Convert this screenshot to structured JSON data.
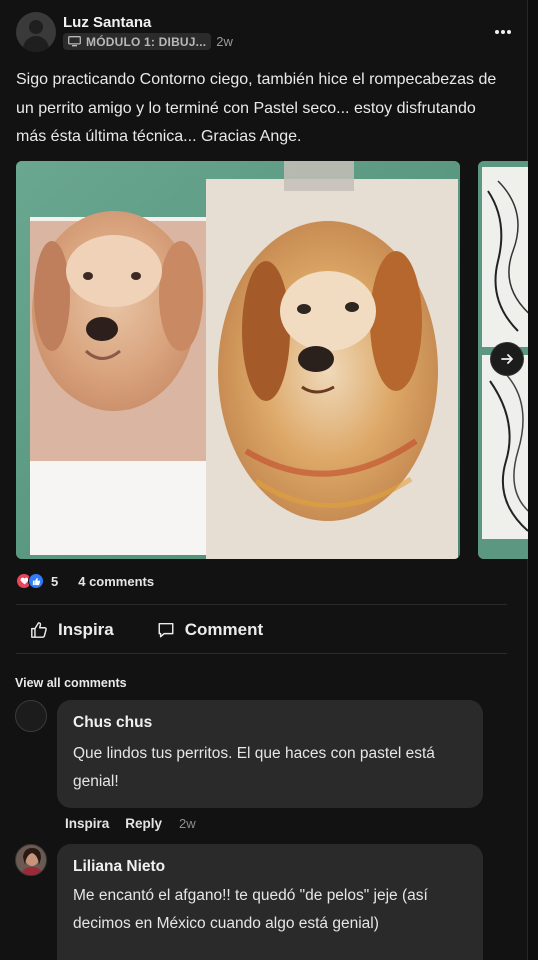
{
  "post": {
    "author": "Luz Santana",
    "module_chip": "MÓDULO 1: DIBUJ...",
    "time_ago": "2w",
    "body": "Sigo practicando Contorno ciego, también hice el rompecabezas de un perrito amigo y lo terminé con Pastel seco... estoy disfrutando más ésta última técnica... Gracias Ange.",
    "more_icon": "more-dots-icon"
  },
  "stats": {
    "reactions_count": "5",
    "comments_label": "4 comments",
    "reaction_icons": [
      "heart-icon",
      "thumbs-up-icon"
    ]
  },
  "actions": {
    "inspira_label": "Inspira",
    "comment_label": "Comment"
  },
  "comments_section": {
    "view_all_label": "View all comments",
    "comments": [
      {
        "author": "Chus chus",
        "text": "Que lindos tus perritos. El que haces con pastel está genial!",
        "inspira_label": "Inspira",
        "reply_label": "Reply",
        "time_ago": "2w"
      },
      {
        "author": "Liliana Nieto",
        "text": "Me encantó el afgano!! te quedó \"de pelos\" jeje (así decimos en México cuando algo está genial)"
      }
    ]
  },
  "colors": {
    "background": "#121212",
    "bubble": "#2a2a2a",
    "heart": "#e9455a",
    "like": "#2f7cf6"
  }
}
